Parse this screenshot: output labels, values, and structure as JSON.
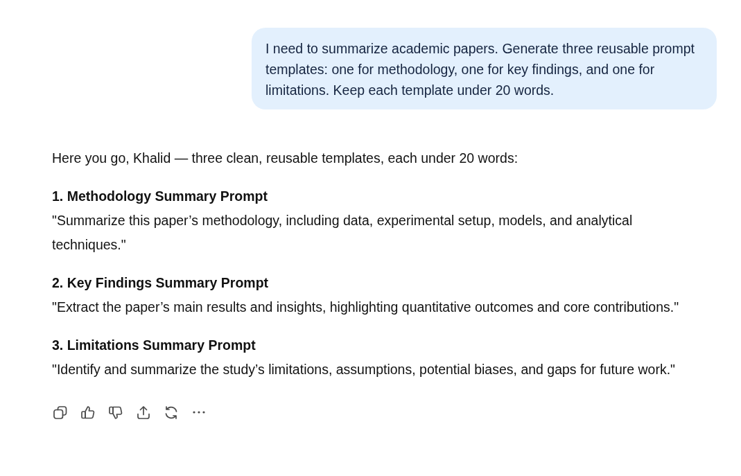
{
  "user_message": {
    "text": "I need to summarize academic papers. Generate three reusable prompt templates: one for methodology, one for key findings, and one for limitations. Keep each template under 20 words."
  },
  "response": {
    "intro": "Here you go, Khalid — three clean, reusable templates, each under 20 words:",
    "sections": [
      {
        "heading": "1. Methodology Summary Prompt",
        "body": "\"Summarize this paper’s methodology, including data, experimental setup, models, and analytical techniques.\""
      },
      {
        "heading": "2. Key Findings Summary Prompt",
        "body": "\"Extract the paper’s main results and insights, highlighting quantitative outcomes and core contributions.\""
      },
      {
        "heading": "3. Limitations Summary Prompt",
        "body": "\"Identify and summarize the study’s limitations, assumptions, potential biases, and gaps for future work.\""
      }
    ]
  },
  "actions": [
    {
      "kind": "copy"
    },
    {
      "kind": "like"
    },
    {
      "kind": "dislike"
    },
    {
      "kind": "share"
    },
    {
      "kind": "regenerate"
    },
    {
      "kind": "more"
    }
  ]
}
